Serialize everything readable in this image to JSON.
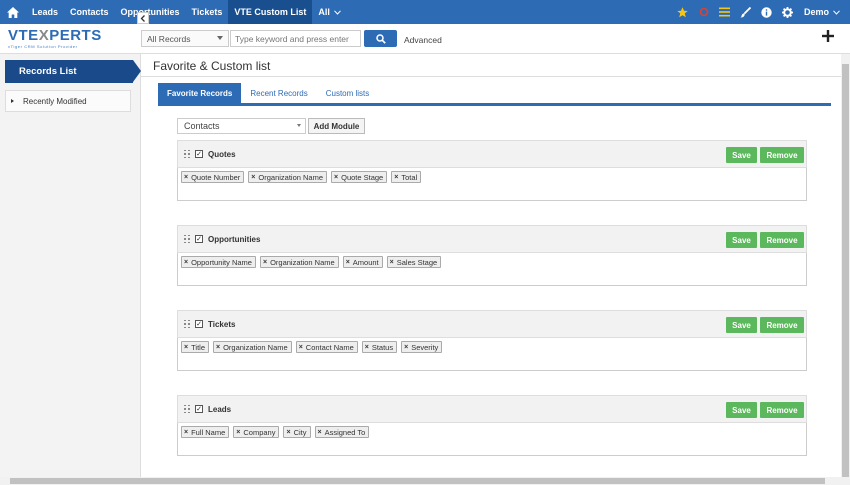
{
  "topnav": {
    "items": [
      {
        "label": "Leads"
      },
      {
        "label": "Contacts"
      },
      {
        "label": "Opportunities"
      },
      {
        "label": "Tickets"
      },
      {
        "label": "VTE Custom List"
      },
      {
        "label": "All"
      }
    ],
    "user": "Demo",
    "colors": {
      "bar": "#2d6bb5",
      "active": "#1a4f8f",
      "star": "#f5c518",
      "alert": "#e0402c"
    }
  },
  "logo": {
    "brand_a": "VTE",
    "brand_x": "X",
    "brand_b": "PERTS",
    "tagline": "vTiger CRM Solution Provider"
  },
  "search": {
    "scope": "All Records",
    "placeholder": "Type keyword and press enter",
    "advanced": "Advanced"
  },
  "sidebar": {
    "header": "Records List",
    "items": [
      {
        "label": "Recently Modified"
      }
    ]
  },
  "main": {
    "title": "Favorite & Custom list",
    "tabs": [
      {
        "label": "Favorite Records"
      },
      {
        "label": "Recent Records"
      },
      {
        "label": "Custom lists"
      }
    ],
    "module_select": "Contacts",
    "add_module": "Add Module",
    "save_label": "Save",
    "remove_label": "Remove",
    "blocks": [
      {
        "name": "Quotes",
        "fields": [
          "Quote Number",
          "Organization Name",
          "Quote Stage",
          "Total"
        ]
      },
      {
        "name": "Opportunities",
        "fields": [
          "Opportunity Name",
          "Organization Name",
          "Amount",
          "Sales Stage"
        ]
      },
      {
        "name": "Tickets",
        "fields": [
          "Title",
          "Organization Name",
          "Contact Name",
          "Status",
          "Severity"
        ]
      },
      {
        "name": "Leads",
        "fields": [
          "Full Name",
          "Company",
          "City",
          "Assigned To"
        ]
      }
    ],
    "colors": {
      "primary": "#2d6bb5",
      "success": "#5cb85c"
    }
  }
}
